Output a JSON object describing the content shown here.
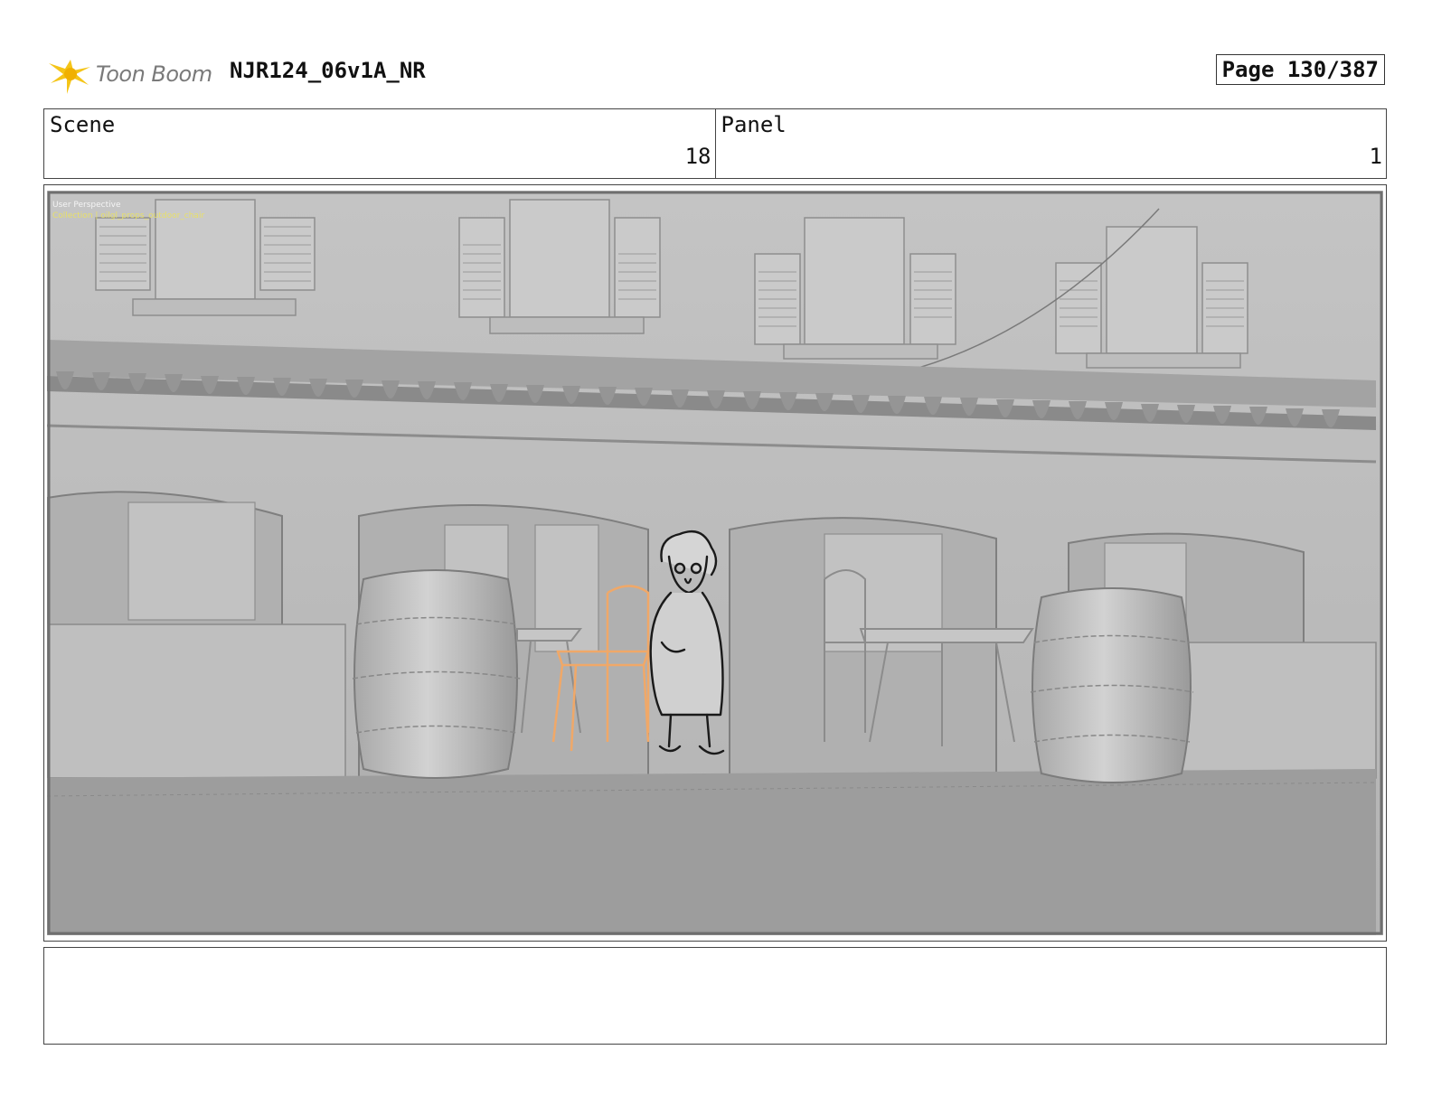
{
  "header": {
    "logo_text": "Toon Boom",
    "project_title": "NJR124_06v1A_NR",
    "page_label": "Page 130/387"
  },
  "info": {
    "scene_label": "Scene",
    "scene_value": "18",
    "panel_label": "Panel",
    "panel_value": "1"
  },
  "viewport": {
    "overlay_title": "User Perspective",
    "overlay_subtitle": "Collection | oilgl_props_outdoor_chair"
  },
  "notes": {
    "text": ""
  },
  "colors": {
    "logo_yellow": "#f5c518",
    "scene_wall": "#b9b9b9",
    "ground": "#9e9e9e",
    "chair_highlight": "#f0a868"
  }
}
